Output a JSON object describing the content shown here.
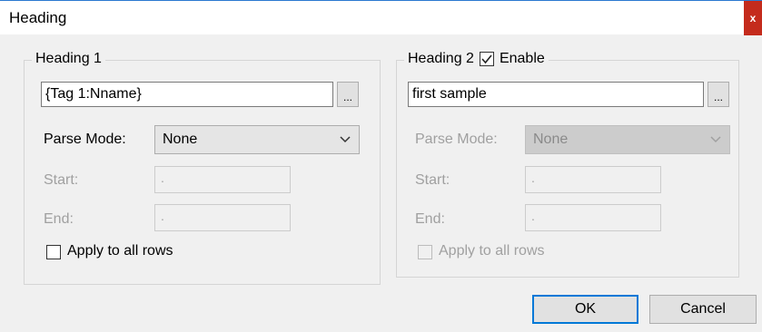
{
  "window": {
    "title": "Heading",
    "close_label": "x"
  },
  "heading1": {
    "legend": "Heading 1",
    "text_value": "{Tag 1:Nname}",
    "browse_label": "...",
    "parse_mode_label": "Parse Mode:",
    "parse_mode_value": "None",
    "start_label": "Start:",
    "start_value": ".",
    "end_label": "End:",
    "end_value": ".",
    "apply_label": "Apply to all rows"
  },
  "heading2": {
    "legend": "Heading 2",
    "enable_label": "Enable",
    "enable_checked": true,
    "text_value": "first sample",
    "browse_label": "...",
    "parse_mode_label": "Parse Mode:",
    "parse_mode_value": "None",
    "start_label": "Start:",
    "start_value": ".",
    "end_label": "End:",
    "end_value": ".",
    "apply_label": "Apply to all rows"
  },
  "buttons": {
    "ok": "OK",
    "cancel": "Cancel"
  },
  "icons": {
    "close": "close-icon",
    "chevron": "chevron-down-icon",
    "check": "check-icon"
  },
  "colors": {
    "accent": "#0078d7",
    "close": "#c42b1c"
  }
}
